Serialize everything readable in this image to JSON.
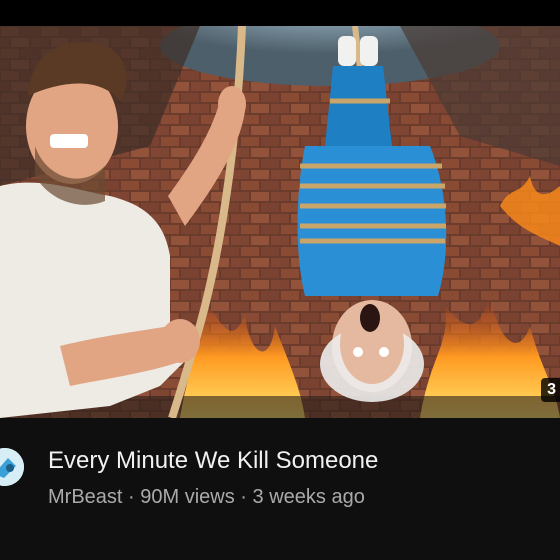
{
  "video": {
    "title": "Every Minute We Kill Someone",
    "channel": "MrBeast",
    "views": "90M views",
    "age": "3 weeks ago",
    "separator": " · ",
    "duration_fragment": "3"
  },
  "icons": {
    "avatar": "channel-avatar"
  },
  "colors": {
    "background": "#0f0f0f",
    "title": "#f1f1f1",
    "subtitle": "#aaaaaa"
  }
}
